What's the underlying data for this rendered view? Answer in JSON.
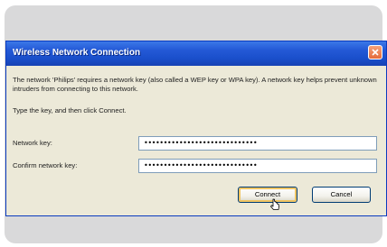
{
  "dialog": {
    "title": "Wireless Network Connection",
    "message": "The network 'Philips' requires a network key (also called a WEP key or WPA key). A network key helps prevent unknown intruders from connecting to this network.",
    "instruction": "Type the key, and then click Connect.",
    "network_key_label": "Network key:",
    "network_key_value": "•••••••••••••••••••••••••••••",
    "confirm_key_label": "Confirm network key:",
    "confirm_key_value": "•••••••••••••••••••••••••••••",
    "connect_label": "Connect",
    "cancel_label": "Cancel"
  },
  "icons": {
    "close": "close-icon",
    "cursor": "mouse-cursor-icon"
  },
  "colors": {
    "titlebar": "#2459d6",
    "close_button": "#e46a3b",
    "dialog_background": "#ece9d8"
  }
}
